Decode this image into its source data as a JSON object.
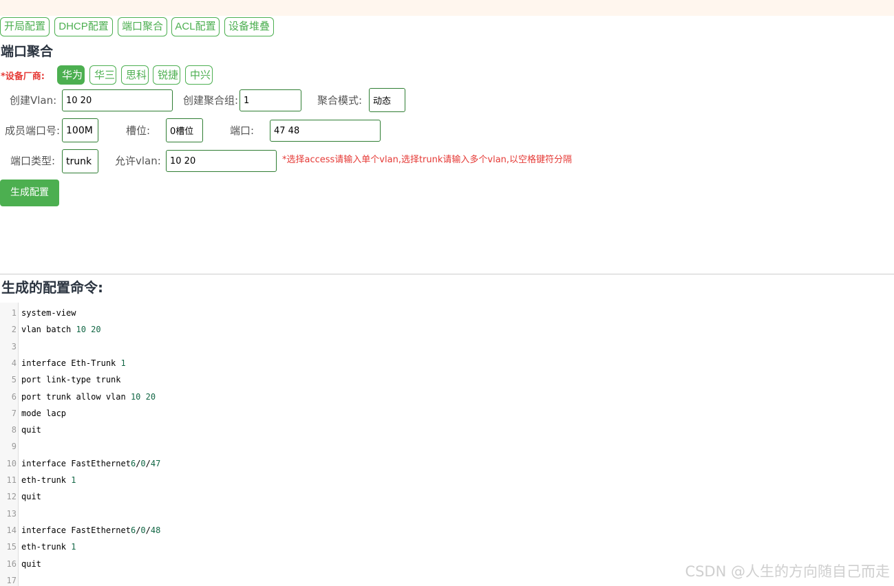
{
  "nav": {
    "items": [
      "开局配置",
      "DHCP配置",
      "端口聚合",
      "ACL配置",
      "设备堆叠"
    ]
  },
  "page_title": "端口聚合",
  "vendor": {
    "label": "*设备厂商:",
    "options": [
      "华为",
      "华三",
      "思科",
      "锐捷",
      "中兴"
    ],
    "selected": "华为"
  },
  "form": {
    "create_vlan_label": "创建Vlan:",
    "create_vlan_value": "10 20",
    "agg_group_label": "创建聚合组:",
    "agg_group_value": "1",
    "agg_mode_label": "聚合模式:",
    "agg_mode_value": "动态",
    "member_port_label": "成员端口号:",
    "member_port_value": "100M",
    "slot_label": "槽位:",
    "slot_value": "0槽位",
    "port_label": "端口:",
    "port_value": "47 48",
    "port_type_label": "端口类型:",
    "port_type_value": "trunk",
    "allow_vlan_label": "允许vlan:",
    "allow_vlan_value": "10 20",
    "hint": "*选择access请输入单个vlan,选择trunk请输入多个vlan,以空格键符分隔"
  },
  "generate_button": "生成配置",
  "output": {
    "title": "生成的配置命令:",
    "lines": [
      "system-view",
      "vlan batch 10 20",
      "",
      "interface Eth-Trunk 1",
      "port link-type trunk",
      "port trunk allow vlan 10 20",
      "mode lacp",
      "quit",
      "",
      "interface FastEthernet6/0/47",
      "eth-trunk 1",
      "quit",
      "",
      "interface FastEthernet6/0/48",
      "eth-trunk 1",
      "quit",
      ""
    ]
  },
  "watermark": "CSDN @人生的方向随自己而走",
  "colors": {
    "accent": "#4caf50",
    "warning": "#e53935",
    "number": "#116644"
  }
}
